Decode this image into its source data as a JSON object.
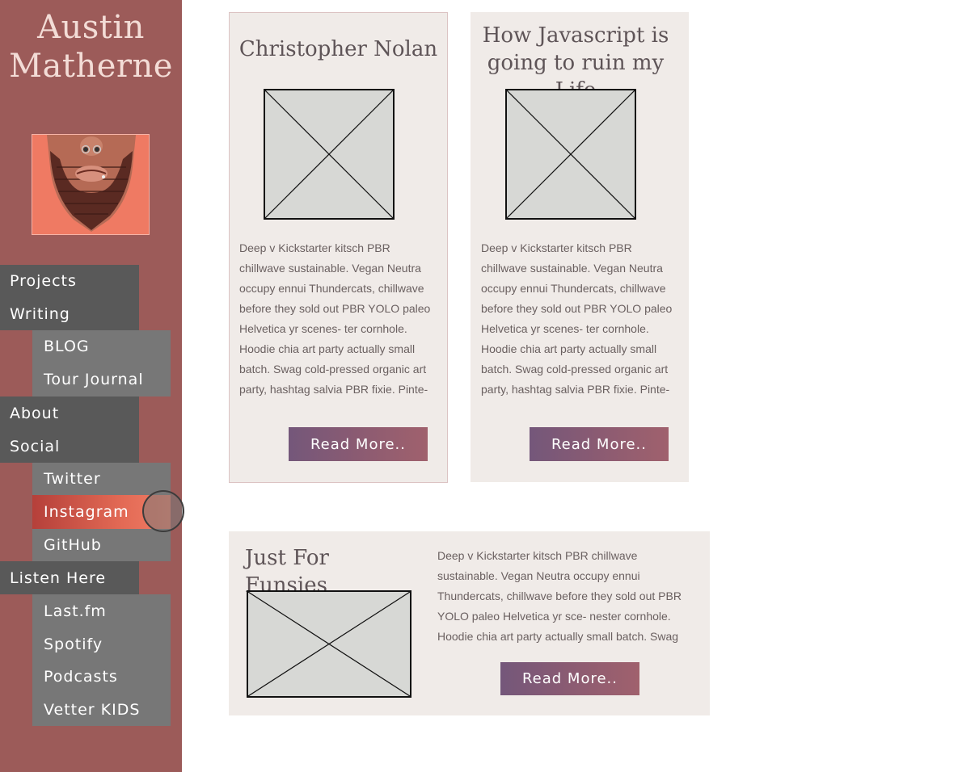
{
  "site": {
    "title_line1": "Austin",
    "title_line2": "Matherne"
  },
  "avatar": {
    "icon": "bearded-face-portrait",
    "bg_color": "#ef7a63"
  },
  "nav": {
    "projects": "Projects",
    "writing": "Writing",
    "blog": "BLOG",
    "tour_journal": "Tour Journal",
    "about": "About",
    "social": "Social",
    "twitter": "Twitter",
    "instagram": "Instagram",
    "github": "GitHub",
    "listen_here": "Listen Here",
    "lastfm": "Last.fm",
    "spotify": "Spotify",
    "podcasts": "Podcasts",
    "vetter_kids": "Vetter KIDS",
    "active_item": "Instagram"
  },
  "cards": [
    {
      "title": "Christopher Nolan",
      "text": "Deep v Kickstarter kitsch PBR chillwave sustainable. Vegan Neutra occupy ennui Thundercats, chillwave before they sold out PBR YOLO paleo Helvetica yr scenes- ter cornhole. Hoodie chia art party actually small batch. Swag cold-pressed organic art party, hashtag salvia PBR fixie. Pinte- rest polaroid XOXO seitan Godard Tru-",
      "button": "Read More.."
    },
    {
      "title": "How Javascript is going to ruin my Life",
      "text": "Deep v Kickstarter kitsch PBR chillwave sustainable. Vegan Neutra occupy ennui Thundercats, chillwave before they sold out PBR YOLO paleo Helvetica yr scenes- ter cornhole. Hoodie chia art party actually small batch. Swag cold-pressed organic art party, hashtag salvia PBR fixie. Pinte- rest polaroid XOXO seitan Godard Tru-",
      "button": "Read More.."
    },
    {
      "title": "Just For Funsies",
      "text": "Deep v Kickstarter kitsch PBR chillwave sustainable. Vegan Neutra occupy ennui Thundercats, chillwave before they sold out PBR YOLO paleo Helvetica yr sce- nester cornhole. Hoodie chia art party actually small batch. Swag cold-pressed organic art party, hashtag",
      "button": "Read More.."
    }
  ],
  "colors": {
    "sidebar": "#9c5b59",
    "nav_dark": "#595959",
    "nav_light": "#777777",
    "active_accent": "#e36a55",
    "card_bg": "#f0ebe8",
    "button_gradient_start": "#74577a",
    "button_gradient_end": "#a0616d"
  }
}
